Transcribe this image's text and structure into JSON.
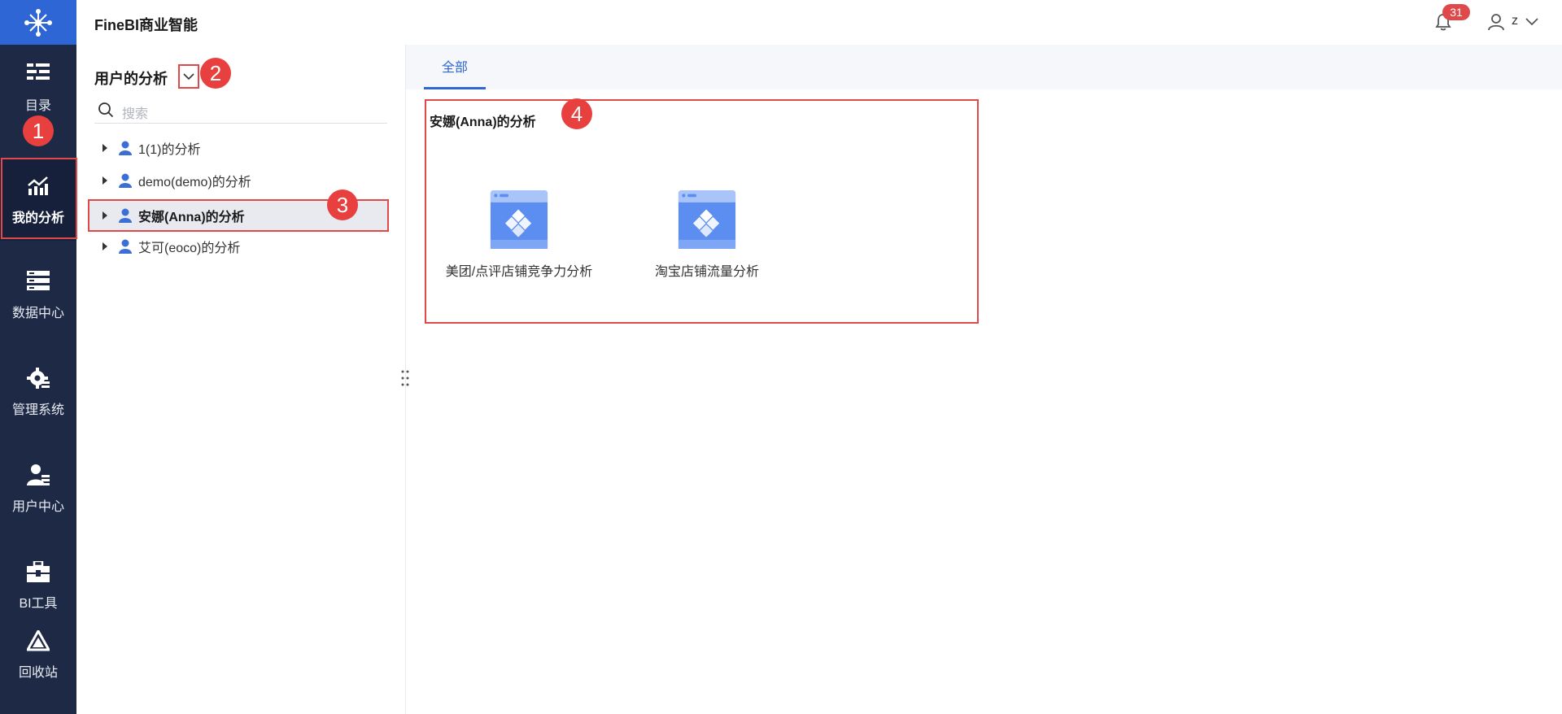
{
  "app": {
    "title": "FineBI商业智能"
  },
  "header": {
    "notification_count": "31",
    "user_name": "z"
  },
  "nav": {
    "items": [
      {
        "label": "目录",
        "icon": "catalog-icon"
      },
      {
        "label": "我的分析",
        "icon": "analysis-icon",
        "active": true
      },
      {
        "label": "数据中心",
        "icon": "data-center-icon"
      },
      {
        "label": "管理系统",
        "icon": "management-gear-icon"
      },
      {
        "label": "用户中心",
        "icon": "user-center-icon"
      },
      {
        "label": "BI工具",
        "icon": "toolbox-icon"
      },
      {
        "label": "回收站",
        "icon": "recycle-bin-icon"
      }
    ]
  },
  "panel": {
    "title": "用户的分析",
    "search_placeholder": "搜索",
    "tree": [
      {
        "label": "1(1)的分析"
      },
      {
        "label": "demo(demo)的分析"
      },
      {
        "label": "安娜(Anna)的分析",
        "selected": true
      },
      {
        "label": "艾可(eoco)的分析"
      }
    ]
  },
  "main": {
    "tabs": [
      {
        "label": "全部",
        "active": true
      }
    ],
    "section_title": "安娜(Anna)的分析",
    "cards": [
      {
        "name": "美团/点评店铺竞争力分析"
      },
      {
        "name": "淘宝店铺流量分析"
      }
    ]
  },
  "annotations": [
    "1",
    "2",
    "3",
    "4"
  ],
  "colors": {
    "nav_bg": "#1e2a45",
    "logo_bg": "#2e66d6",
    "accent": "#2e66d6",
    "highlight": "#e0494a"
  }
}
